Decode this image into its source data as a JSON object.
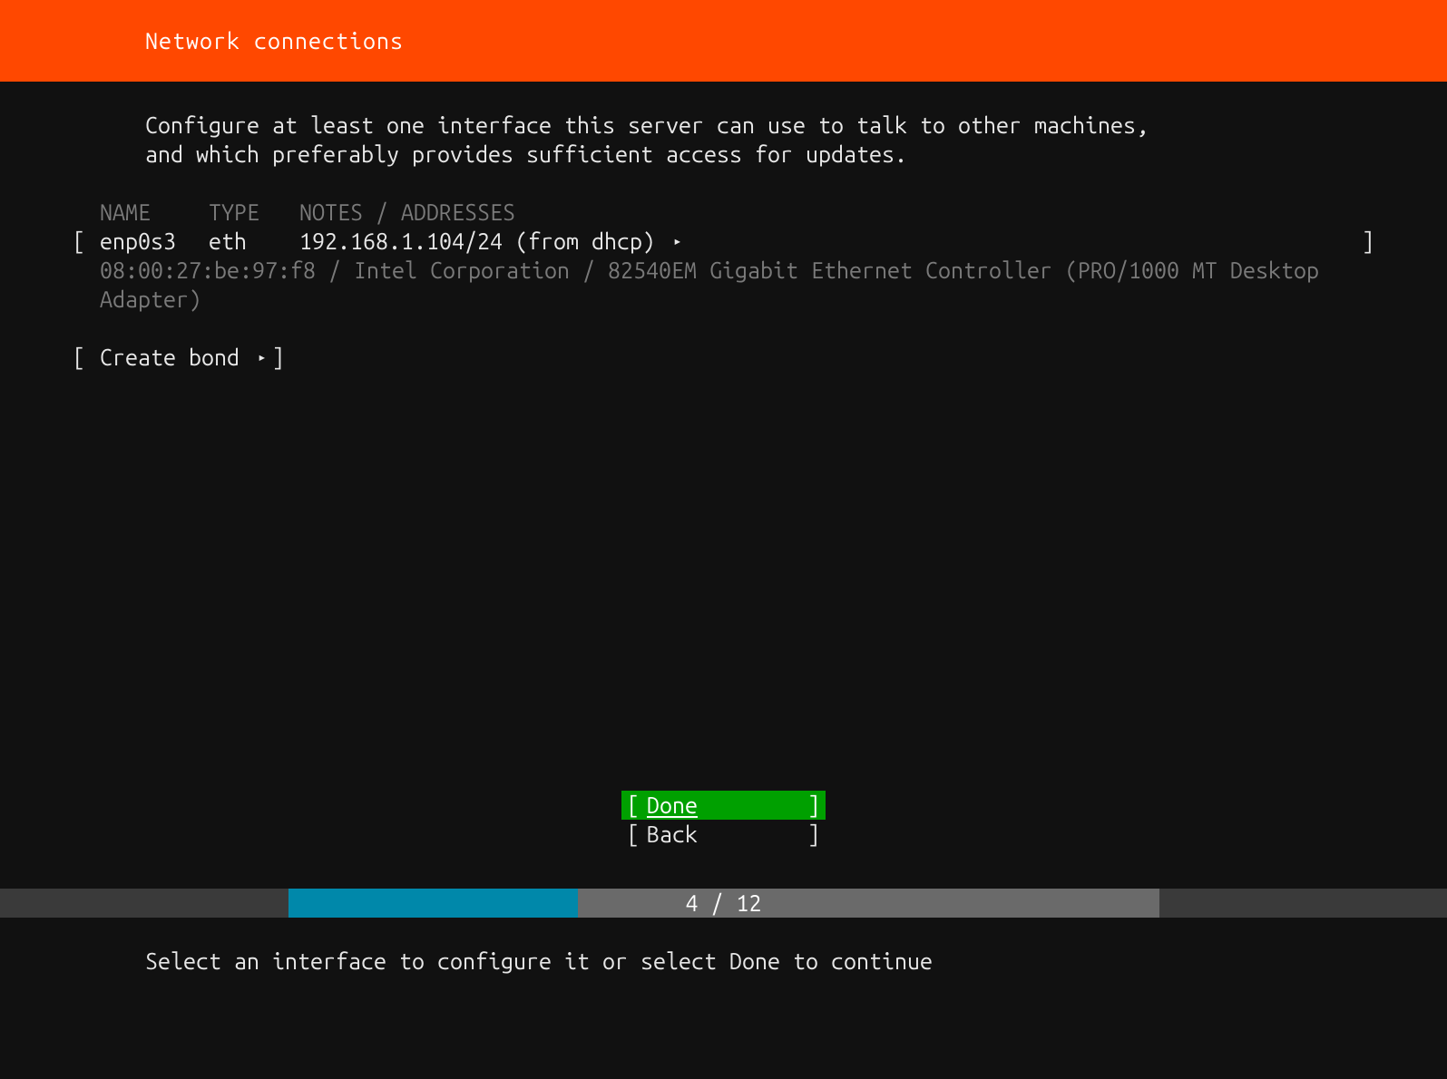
{
  "header": {
    "title": "Network connections"
  },
  "intro": "Configure at least one interface this server can use to talk to other machines,\nand which preferably provides sufficient access for updates.",
  "columns": {
    "name": "NAME",
    "type": "TYPE",
    "notes": "NOTES / ADDRESSES"
  },
  "interfaces": [
    {
      "name": "enp0s3",
      "type": "eth",
      "notes": "192.168.1.104/24 (from dhcp)",
      "detail": "08:00:27:be:97:f8 / Intel Corporation / 82540EM Gigabit Ethernet Controller (PRO/1000 MT Desktop Adapter)"
    }
  ],
  "create_bond": {
    "label": "Create bond"
  },
  "buttons": {
    "done": "Done",
    "back": "Back"
  },
  "progress": {
    "current": 4,
    "total": 12,
    "label": "4 / 12",
    "percent": 33.3
  },
  "hint": "Select an interface to configure it or select Done to continue",
  "glyphs": {
    "triangle": "▸",
    "lbracket": "[",
    "rbracket": "]"
  }
}
